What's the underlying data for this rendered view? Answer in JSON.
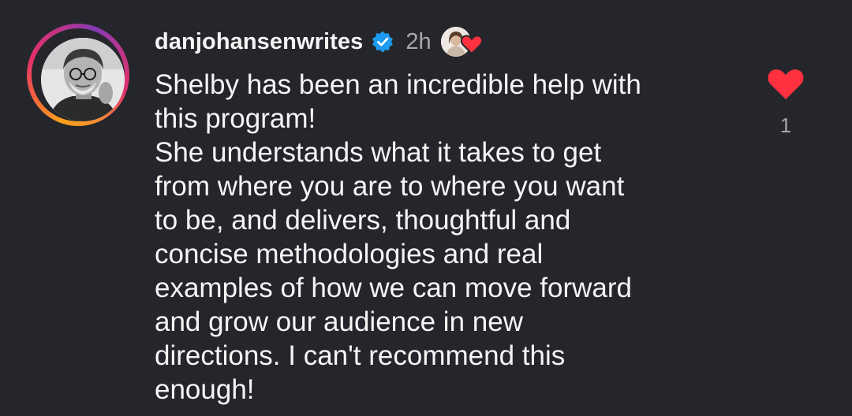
{
  "comment": {
    "username": "danjohansenwrites",
    "verified": true,
    "timestamp": "2h",
    "liked_by_creator": true,
    "text": "Shelby has been an incredible help with\nthis program!\nShe understands what it takes to get\nfrom where you are to where you want\nto be, and delivers, thoughtful and\nconcise methodologies and real\nexamples of how we can move forward\nand grow our audience in new\ndirections. I can't recommend this\nenough!",
    "like_count": "1",
    "liked": true
  },
  "icons": {
    "verified": "verified-badge-icon",
    "like": "heart-icon",
    "creator_like": "creator-heart-icon"
  },
  "colors": {
    "background": "#25262b",
    "text": "#f5f5f5",
    "secondary_text": "#a8a8a8",
    "verified": "#1d9bf0",
    "heart": "#ff3040"
  }
}
